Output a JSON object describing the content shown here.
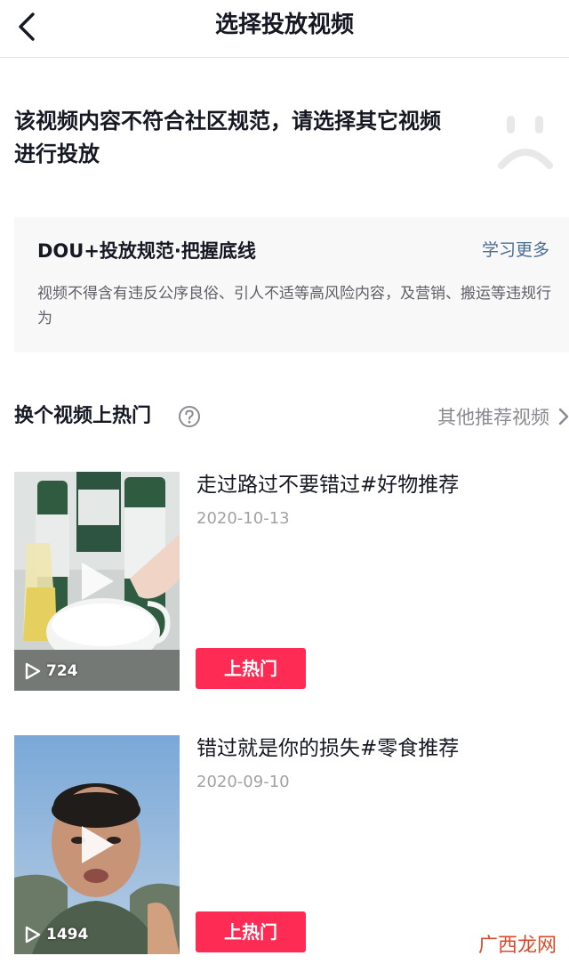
{
  "header": {
    "title": "选择投放视频"
  },
  "notice": {
    "text": "该视频内容不符合社区规范，请选择其它视频进行投放"
  },
  "rules": {
    "title": "DOU+投放规范·把握底线",
    "link": "学习更多",
    "description": "视频不得含有违反公序良俗、引人不适等高风险内容，及营销、搬运等违规行为"
  },
  "section": {
    "title": "换个视频上热门",
    "more_label": "其他推荐视频"
  },
  "videos": [
    {
      "title": "走过路过不要错过#好物推荐",
      "date": "2020-10-13",
      "views": "724",
      "button_label": "上热门"
    },
    {
      "title": "错过就是你的损失#零食推荐",
      "date": "2020-09-10",
      "views": "1494",
      "button_label": "上热门"
    }
  ],
  "watermark": {
    "text": "广西龙网"
  },
  "colors": {
    "accent": "#fe2c55",
    "link": "#4a6d94",
    "card_bg": "#f8f8f8",
    "secondary_text": "#a1a2a7"
  },
  "icons": {
    "back": "chevron-left-icon",
    "sad_face": "sad-face-icon",
    "help": "question-circle-icon",
    "more": "chevron-right-icon",
    "play": "play-icon"
  }
}
